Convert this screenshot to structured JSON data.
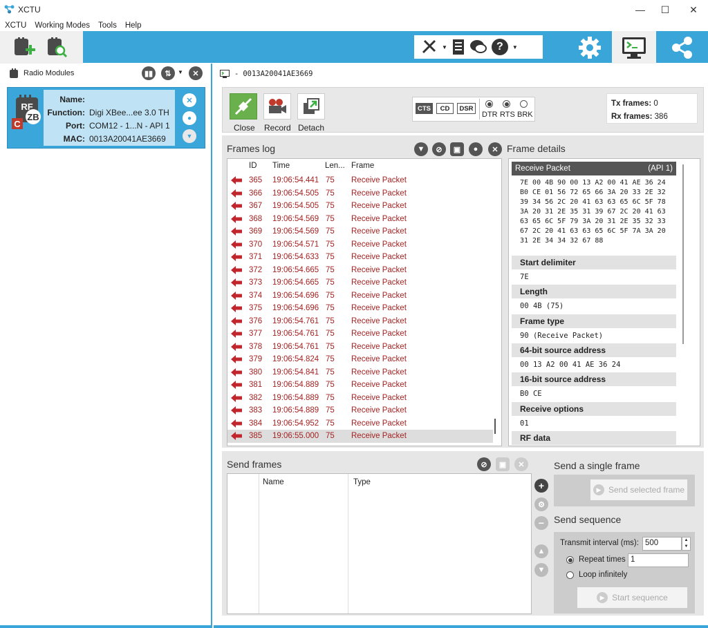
{
  "app": {
    "title": "XCTU"
  },
  "menu": [
    "XCTU",
    "Working Modes",
    "Tools",
    "Help"
  ],
  "left": {
    "title": "Radio Modules",
    "module": {
      "name_label": "Name:",
      "name_value": "",
      "function_label": "Function:",
      "function_value": "Digi XBee...ee 3.0 TH",
      "port_label": "Port:",
      "port_value": "COM12 - 1...N - API 1",
      "mac_label": "MAC:",
      "mac_value": "0013A20041AE3669"
    }
  },
  "console": {
    "device": "0013A20041AE3669",
    "buttons": {
      "close": "Close",
      "record": "Record",
      "detach": "Detach"
    },
    "lines": {
      "cts": "CTS",
      "cd": "CD",
      "dsr": "DSR",
      "dtr": "DTR",
      "rts": "RTS",
      "brk": "BRK"
    },
    "tx_label": "Tx frames:",
    "tx_value": "0",
    "rx_label": "Rx frames:",
    "rx_value": "386"
  },
  "frames_log": {
    "title": "Frames log",
    "columns": [
      "ID",
      "Time",
      "Len...",
      "Frame"
    ],
    "rows": [
      {
        "id": "365",
        "time": "19:06:54.441",
        "len": "75",
        "frame": "Receive Packet"
      },
      {
        "id": "366",
        "time": "19:06:54.505",
        "len": "75",
        "frame": "Receive Packet"
      },
      {
        "id": "367",
        "time": "19:06:54.505",
        "len": "75",
        "frame": "Receive Packet"
      },
      {
        "id": "368",
        "time": "19:06:54.569",
        "len": "75",
        "frame": "Receive Packet"
      },
      {
        "id": "369",
        "time": "19:06:54.569",
        "len": "75",
        "frame": "Receive Packet"
      },
      {
        "id": "370",
        "time": "19:06:54.571",
        "len": "75",
        "frame": "Receive Packet"
      },
      {
        "id": "371",
        "time": "19:06:54.633",
        "len": "75",
        "frame": "Receive Packet"
      },
      {
        "id": "372",
        "time": "19:06:54.665",
        "len": "75",
        "frame": "Receive Packet"
      },
      {
        "id": "373",
        "time": "19:06:54.665",
        "len": "75",
        "frame": "Receive Packet"
      },
      {
        "id": "374",
        "time": "19:06:54.696",
        "len": "75",
        "frame": "Receive Packet"
      },
      {
        "id": "375",
        "time": "19:06:54.696",
        "len": "75",
        "frame": "Receive Packet"
      },
      {
        "id": "376",
        "time": "19:06:54.761",
        "len": "75",
        "frame": "Receive Packet"
      },
      {
        "id": "377",
        "time": "19:06:54.761",
        "len": "75",
        "frame": "Receive Packet"
      },
      {
        "id": "378",
        "time": "19:06:54.761",
        "len": "75",
        "frame": "Receive Packet"
      },
      {
        "id": "379",
        "time": "19:06:54.824",
        "len": "75",
        "frame": "Receive Packet"
      },
      {
        "id": "380",
        "time": "19:06:54.841",
        "len": "75",
        "frame": "Receive Packet"
      },
      {
        "id": "381",
        "time": "19:06:54.889",
        "len": "75",
        "frame": "Receive Packet"
      },
      {
        "id": "382",
        "time": "19:06:54.889",
        "len": "75",
        "frame": "Receive Packet"
      },
      {
        "id": "383",
        "time": "19:06:54.889",
        "len": "75",
        "frame": "Receive Packet"
      },
      {
        "id": "384",
        "time": "19:06:54.952",
        "len": "75",
        "frame": "Receive Packet"
      },
      {
        "id": "385",
        "time": "19:06:55.000",
        "len": "75",
        "frame": "Receive Packet"
      }
    ]
  },
  "frame_details": {
    "title": "Frame details",
    "header": "Receive Packet",
    "api": "(API 1)",
    "hex": "7E 00 4B 90 00 13 A2 00 41 AE 36 24\nB0 CE 01 56 72 65 66 3A 20 33 2E 32\n39 34 56 2C 20 41 63 63 65 6C 5F 78\n3A 20 31 2E 35 31 39 67 2C 20 41 63\n63 65 6C 5F 79 3A 20 31 2E 35 32 33\n67 2C 20 41 63 63 65 6C 5F 7A 3A 20\n31 2E 34 34 32 67 88",
    "fields": [
      {
        "name": "Start delimiter",
        "value": "7E"
      },
      {
        "name": "Length",
        "value": "00 4B (75)"
      },
      {
        "name": "Frame type",
        "value": "90 (Receive Packet)"
      },
      {
        "name": "64-bit source address",
        "value": "00 13 A2 00 41 AE 36 24"
      },
      {
        "name": "16-bit source address",
        "value": "B0 CE"
      },
      {
        "name": "Receive options",
        "value": "01"
      },
      {
        "name": "RF data",
        "value": ""
      }
    ]
  },
  "send": {
    "title": "Send frames",
    "columns": [
      "Name",
      "Type"
    ],
    "single_title": "Send a single frame",
    "send_selected": "Send selected frame",
    "sequence_title": "Send sequence",
    "interval_label": "Transmit interval (ms):",
    "interval_value": "500",
    "repeat_label": "Repeat times",
    "repeat_value": "1",
    "loop_label": "Loop infinitely",
    "start_sequence": "Start sequence"
  }
}
